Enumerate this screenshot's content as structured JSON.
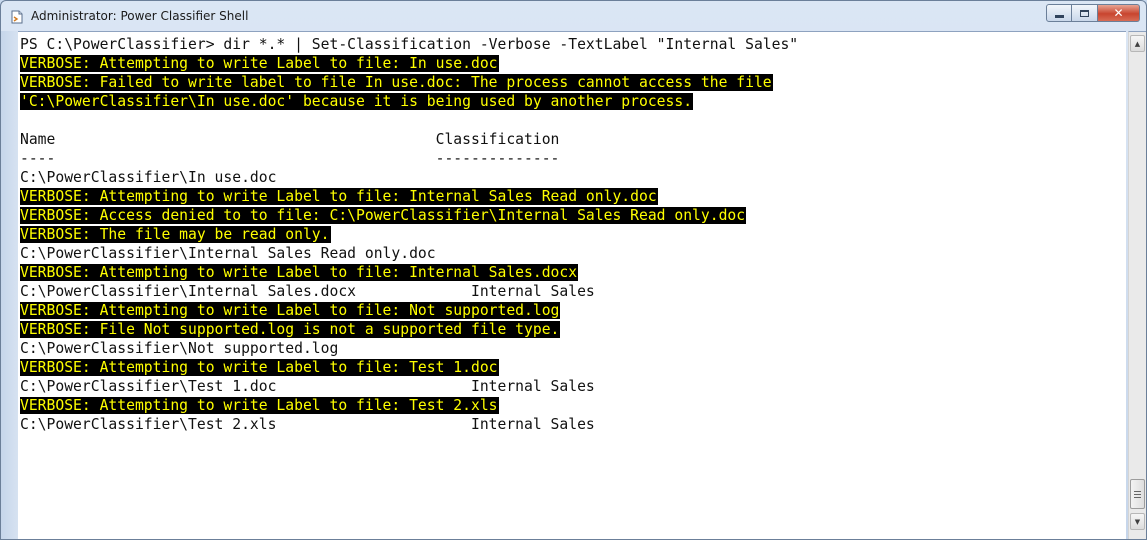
{
  "window": {
    "title": "Administrator: Power Classifier Shell",
    "caption_buttons": {
      "minimize": "minimize",
      "maximize": "maximize",
      "close": "✕"
    }
  },
  "colors": {
    "console_bg": "#ffffff",
    "console_fg": "#111111",
    "verbose_bg": "#000000",
    "verbose_fg": "#ffff00",
    "close_button": "#c8452f"
  },
  "icons": [
    "app-shell-icon",
    "minimize-icon",
    "maximize-icon",
    "close-icon",
    "scroll-up-icon",
    "scroll-down-icon"
  ],
  "console": {
    "lines": [
      {
        "text": "PS C:\\PowerClassifier> dir *.* | Set-Classification -Verbose -TextLabel \"Internal Sales\"",
        "verbose": false
      },
      {
        "text": "VERBOSE: Attempting to write Label to file: In use.doc",
        "verbose": true
      },
      {
        "text": "VERBOSE: Failed to write label to file In use.doc: The process cannot access the file",
        "verbose": true
      },
      {
        "text": "'C:\\PowerClassifier\\In use.doc' because it is being used by another process.",
        "verbose": true
      },
      {
        "text": "",
        "verbose": false
      },
      {
        "text": "Name                                           Classification",
        "verbose": false
      },
      {
        "text": "----                                           --------------",
        "verbose": false
      },
      {
        "text": "C:\\PowerClassifier\\In use.doc",
        "verbose": false
      },
      {
        "text": "VERBOSE: Attempting to write Label to file: Internal Sales Read only.doc",
        "verbose": true
      },
      {
        "text": "VERBOSE: Access denied to to file: C:\\PowerClassifier\\Internal Sales Read only.doc",
        "verbose": true
      },
      {
        "text": "VERBOSE: The file may be read only.",
        "verbose": true
      },
      {
        "text": "C:\\PowerClassifier\\Internal Sales Read only.doc",
        "verbose": false
      },
      {
        "text": "VERBOSE: Attempting to write Label to file: Internal Sales.docx",
        "verbose": true
      },
      {
        "text": "C:\\PowerClassifier\\Internal Sales.docx             Internal Sales",
        "verbose": false
      },
      {
        "text": "VERBOSE: Attempting to write Label to file: Not supported.log",
        "verbose": true
      },
      {
        "text": "VERBOSE: File Not supported.log is not a supported file type.",
        "verbose": true
      },
      {
        "text": "C:\\PowerClassifier\\Not supported.log",
        "verbose": false
      },
      {
        "text": "VERBOSE: Attempting to write Label to file: Test 1.doc",
        "verbose": true
      },
      {
        "text": "C:\\PowerClassifier\\Test 1.doc                      Internal Sales",
        "verbose": false
      },
      {
        "text": "VERBOSE: Attempting to write Label to file: Test 2.xls",
        "verbose": true
      },
      {
        "text": "C:\\PowerClassifier\\Test 2.xls                      Internal Sales",
        "verbose": false
      }
    ]
  }
}
